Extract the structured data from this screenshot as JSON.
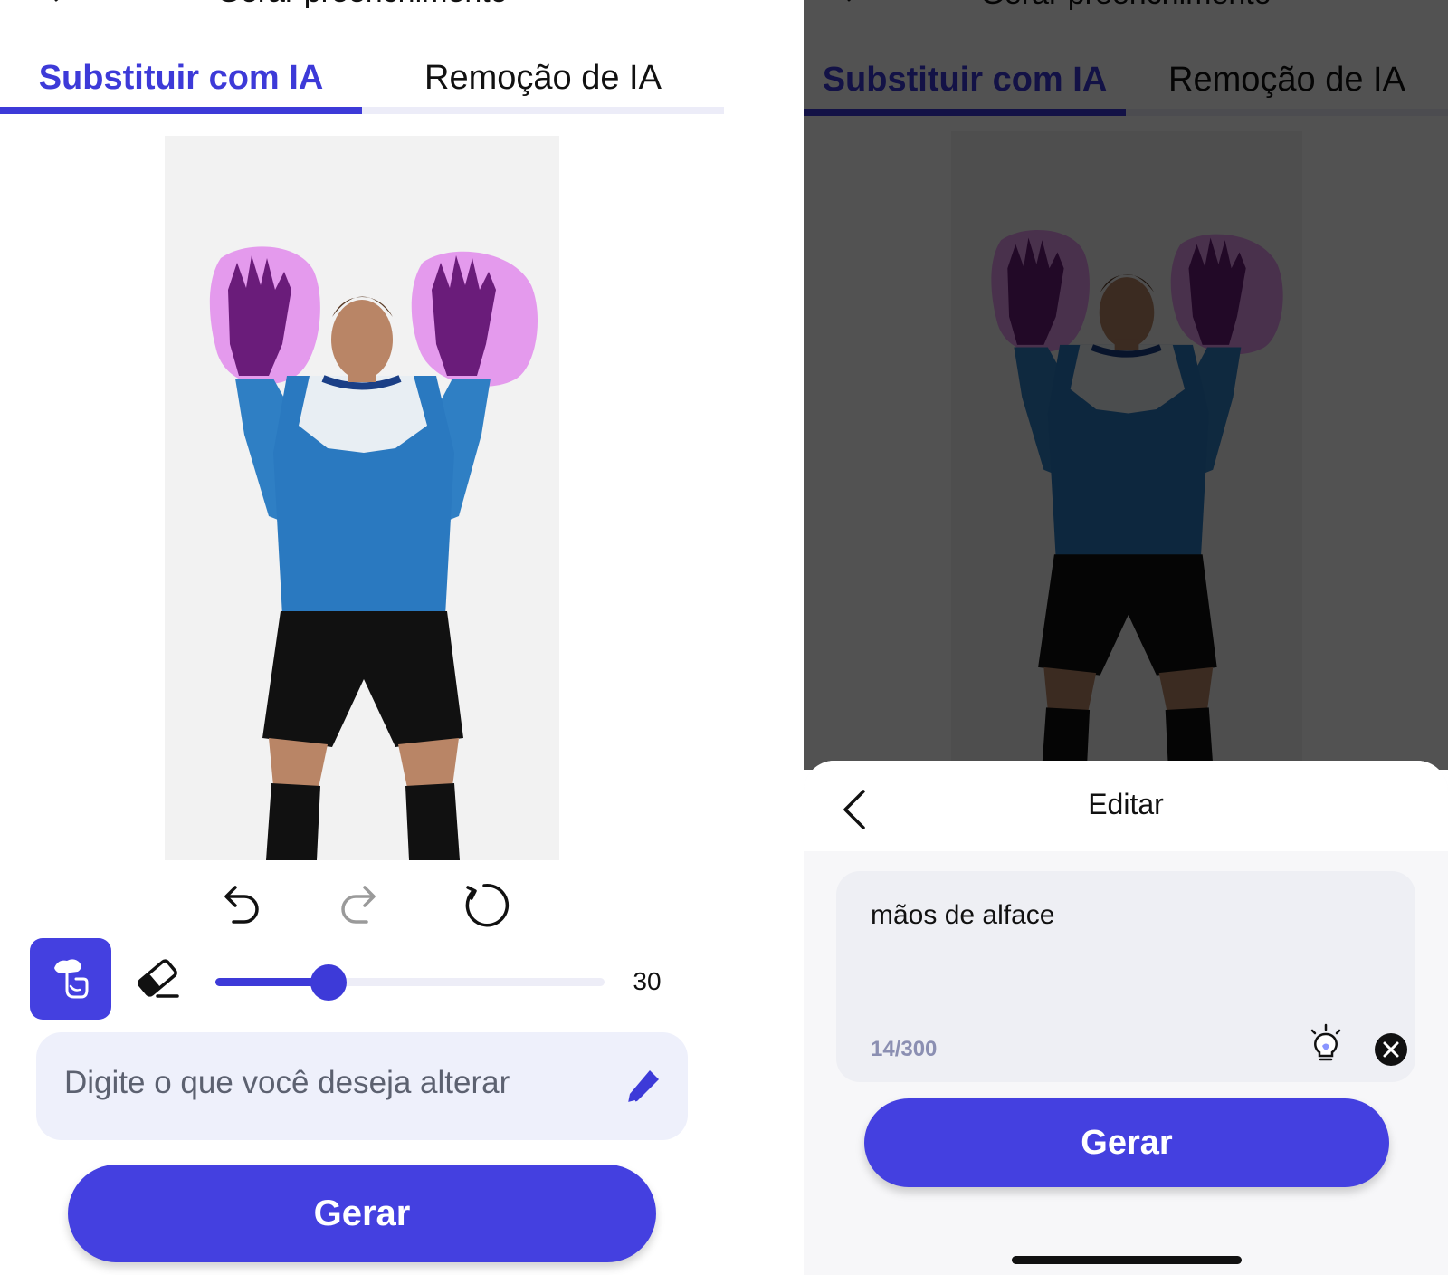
{
  "header": {
    "title": "Gerar preenchimento"
  },
  "tabs": [
    {
      "label": "Substituir com IA",
      "active": true
    },
    {
      "label": "Remoção de IA",
      "active": false
    }
  ],
  "tools": {
    "undo_icon": "undo-icon",
    "redo_icon": "redo-icon",
    "reset_icon": "reset-icon",
    "brush_icon": "brush-tap-icon",
    "eraser_icon": "eraser-icon",
    "brush_size": 30,
    "brush_size_label": "30",
    "brush_size_fraction": 0.29
  },
  "prompt": {
    "placeholder": "Digite o que você deseja alterar",
    "edit_icon": "pen-icon"
  },
  "primary_button": {
    "label": "Gerar"
  },
  "edit_sheet": {
    "title": "Editar",
    "text": "mãos de alface",
    "counter": "14/300",
    "bulb_icon": "lightbulb-icon",
    "clear_icon": "clear-circle-icon",
    "button_label": "Gerar"
  },
  "colors": {
    "accent": "#3d3ad8",
    "button": "#4440e0",
    "mask": "#e28bec",
    "input_bg": "#eef0fb",
    "overlay": "rgba(0,0,0,0.68)"
  }
}
